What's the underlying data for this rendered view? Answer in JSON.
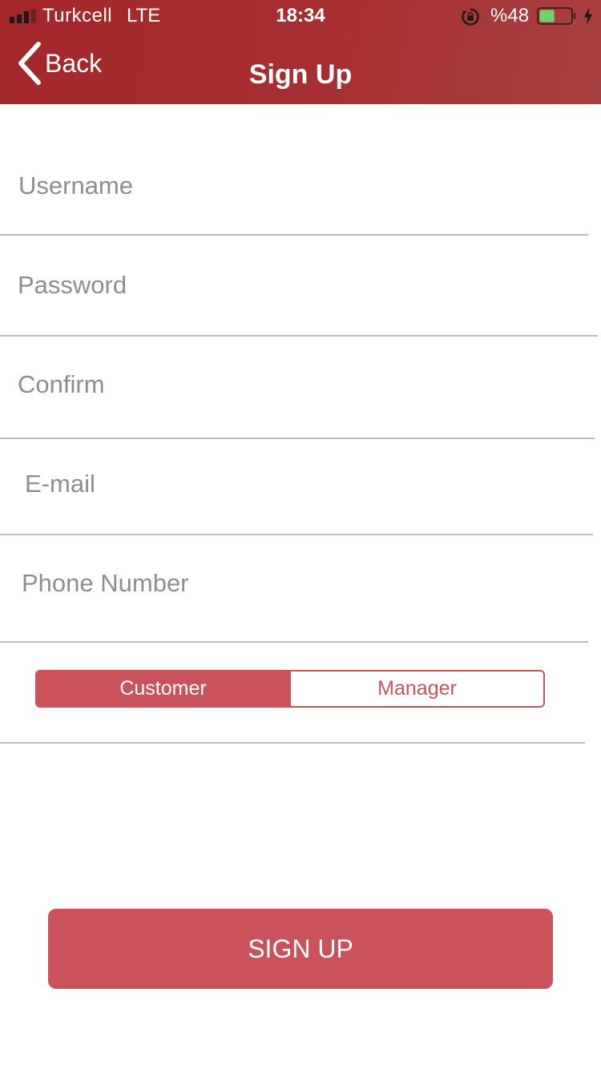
{
  "status_bar": {
    "carrier": "Turkcell",
    "network": "LTE",
    "time": "18:34",
    "battery_percent": "%48",
    "battery_level": 0.48,
    "icons": [
      "signal-bars-icon",
      "rotation-lock-icon",
      "battery-icon",
      "charging-bolt-icon"
    ]
  },
  "nav": {
    "back_label": "Back",
    "title": "Sign Up"
  },
  "form": {
    "username": {
      "placeholder": "Username",
      "value": ""
    },
    "password": {
      "placeholder": "Password",
      "value": ""
    },
    "confirm": {
      "placeholder": "Confirm",
      "value": ""
    },
    "email": {
      "placeholder": "E-mail",
      "value": ""
    },
    "phone": {
      "placeholder": "Phone Number",
      "value": ""
    }
  },
  "role_selector": {
    "options": [
      "Customer",
      "Manager"
    ],
    "selected": "Customer"
  },
  "signup_button": {
    "label": "SIGN UP"
  },
  "colors": {
    "header": "#a3272a",
    "accent": "#c9525b",
    "divider": "#bcbcbc",
    "placeholder": "#8e8e8e"
  }
}
